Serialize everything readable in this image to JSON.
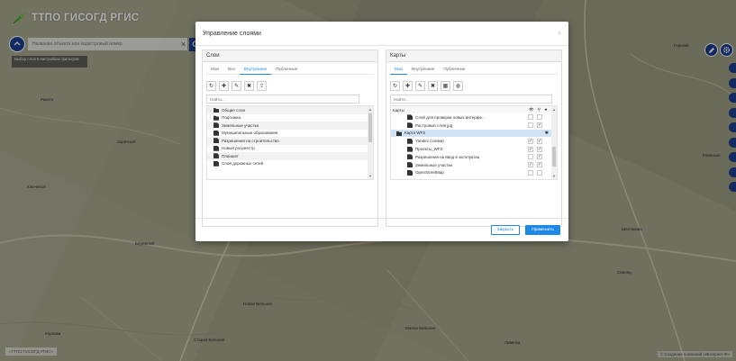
{
  "app": {
    "title": "ТТПО ГИСОГД РГИС"
  },
  "search": {
    "placeholder": "Название объекта или кадастровый номер",
    "filter_chip": "Выбор слоя в настройках фильтров"
  },
  "map": {
    "towns": [
      "Ракити",
      "Заречный",
      "Ключевой",
      "Бережной",
      "Новая Бельная",
      "Старая Бельная",
      "Карлаки",
      "Малое Бельное",
      "Шестаково",
      "Ливенка",
      "Ровеньки",
      "Горький",
      "Свинец"
    ],
    "attribution_left": "«ТТПО ГИСОГД РГИС»",
    "attribution_right": "© Создание компаний «Интернет-Ф»"
  },
  "modal": {
    "title": "Управление слоями",
    "close_glyph": "×",
    "footer": {
      "close_label": "Закрыть",
      "apply_label": "Применить"
    },
    "layers_panel": {
      "heading": "Слои",
      "tabs": [
        "Мои",
        "Все",
        "Внутренние",
        "Публичные"
      ],
      "active_tab": "Внутренние",
      "search_placeholder": "Найти...",
      "items": [
        {
          "label": "Общие слои",
          "kind": "folder"
        },
        {
          "label": "Подложка",
          "kind": "folder"
        },
        {
          "label": "Земельные участки",
          "kind": "doc"
        },
        {
          "label": "Муниципальные образования",
          "kind": "doc"
        },
        {
          "label": "Разрешения на строительство",
          "kind": "doc"
        },
        {
          "label": "Новый росреестр",
          "kind": "doc"
        },
        {
          "label": "Планшет",
          "kind": "doc"
        },
        {
          "label": "Слой дорожных сетей",
          "kind": "doc"
        }
      ]
    },
    "maps_panel": {
      "heading": "Карты",
      "tabs": [
        "Мои",
        "Внутренние",
        "Публичные"
      ],
      "active_tab": "Мои",
      "search_placeholder": "Найти...",
      "tree_header": "Карты",
      "rows": [
        {
          "label": "Слой для проверки новых интерфе...",
          "level": 2,
          "c1": false,
          "c2": false,
          "star": false
        },
        {
          "label": "Растровый слой jpg",
          "level": 2,
          "c1": false,
          "c2": true,
          "star": false
        },
        {
          "label": "Карта WFS",
          "level": 1,
          "c1": false,
          "c2": false,
          "star": true,
          "selected": true
        },
        {
          "label": "Yandex (схема)",
          "level": 2,
          "c1": true,
          "c2": true,
          "star": false
        },
        {
          "label": "Проекты_WFS",
          "level": 2,
          "c1": true,
          "c2": true,
          "star": false
        },
        {
          "label": "Разрешения на ввод в эксплуатац",
          "level": 2,
          "c1": false,
          "c2": true,
          "star": false
        },
        {
          "label": "Земельные участки",
          "level": 2,
          "c1": true,
          "c2": true,
          "star": false
        },
        {
          "label": "OpenStreetMap",
          "level": 2,
          "c1": false,
          "c2": false,
          "star": false
        }
      ]
    }
  },
  "colors": {
    "accent": "#1e88e5",
    "brand": "#1b3f8f",
    "danger": "#d23b3b",
    "selected_row": "#cfe3f4"
  }
}
